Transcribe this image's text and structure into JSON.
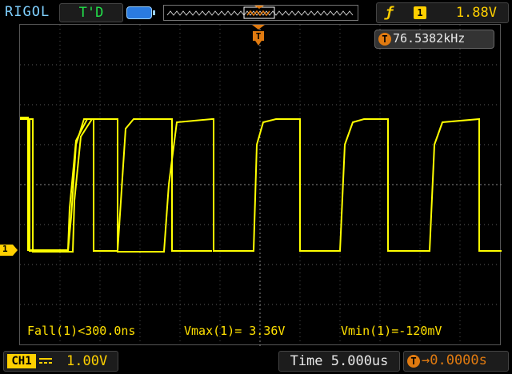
{
  "topbar": {
    "brand": "RIGOL",
    "trigger_status": "T'D",
    "trigger_channel_badge": "1",
    "trigger_level": "1.88V"
  },
  "frequency_counter": {
    "icon_letter": "T",
    "value": "76.5382kHz"
  },
  "channel_marker": "1",
  "measurements": {
    "fall": "Fall(1)<300.0ns",
    "vmax": "Vmax(1)= 3.36V",
    "vmin": "Vmin(1)=-120mV"
  },
  "bottombar": {
    "channel_label": "CH1",
    "vertical_scale": "1.00V",
    "timebase": "Time 5.000us",
    "trigger_offset_icon": "T",
    "trigger_offset": "→0.0000s"
  },
  "colors": {
    "trace": "#ffff00",
    "channel": "#ffd000",
    "trigger": "#e07a10",
    "brand": "#7fd0ff"
  },
  "icons": [
    "battery-icon",
    "rising-edge-icon",
    "trigger-position-icon",
    "dc-coupling-icon"
  ]
}
